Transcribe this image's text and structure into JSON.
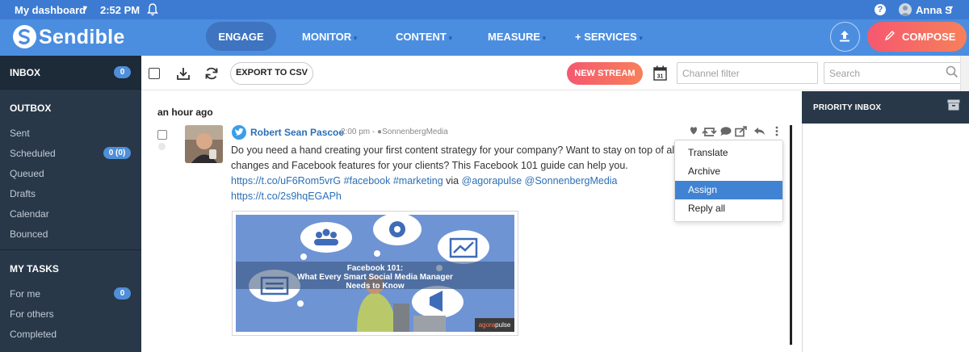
{
  "topbar": {
    "dashboard_label": "My dashboard",
    "caret_icon": "caret-down-icon",
    "time": "2:52 PM",
    "bell_icon": "bell-icon",
    "help_icon": "help-icon",
    "help_glyph": "?",
    "user_name": "Anna S"
  },
  "brand": {
    "name": "Sendible",
    "logo_icon": "sendible-logo-icon"
  },
  "nav": {
    "engage": "ENGAGE",
    "monitor": "MONITOR",
    "content": "CONTENT",
    "measure": "MEASURE",
    "services": "+ SERVICES",
    "compose": "COMPOSE",
    "upload_icon": "upload-icon",
    "compose_icon": "pencil-icon"
  },
  "sidebar": {
    "inbox": {
      "label": "INBOX",
      "count": "0"
    },
    "outbox_heading": "OUTBOX",
    "outbox_items": [
      {
        "label": "Sent"
      },
      {
        "label": "Scheduled",
        "count": "0 (0)"
      },
      {
        "label": "Queued"
      },
      {
        "label": "Drafts"
      },
      {
        "label": "Calendar"
      },
      {
        "label": "Bounced"
      }
    ],
    "tasks_heading": "MY TASKS",
    "task_items": [
      {
        "label": "For me",
        "count": "0"
      },
      {
        "label": "For others"
      },
      {
        "label": "Completed"
      }
    ]
  },
  "toolbar": {
    "export_label": "EXPORT TO CSV",
    "new_stream_label": "NEW STREAM",
    "calendar_day": "31",
    "channel_filter_placeholder": "Channel filter",
    "search_placeholder": "Search",
    "icons": [
      "select-all-checkbox",
      "download-icon",
      "refresh-icon",
      "calendar-icon",
      "search-icon"
    ]
  },
  "feed": {
    "time_group": "an hour ago",
    "post": {
      "author": "Robert Sean Pascoe",
      "time": "2:00 pm -",
      "channel": "SonnenbergMedia",
      "text_line1": "Do you need a hand creating your first content strategy for your company? Want to stay on top of algo",
      "text_line2": "changes and Facebook features for your clients? This Facebook 101 guide can help you.",
      "link1": "https://t.co/uF6Rom5vrG",
      "tag1": "#facebook",
      "tag2": "#marketing",
      "via": "via",
      "mention1": "@agorapulse",
      "mention2": "@SonnenbergMedia",
      "link2": "https://t.co/2s9hqEGAPh",
      "image": {
        "title_line1": "Facebook 101:",
        "title_line2": "What Every Smart Social Media Manager",
        "title_line3": "Needs to Know",
        "brand_a": "agora",
        "brand_b": "pulse"
      },
      "actions": [
        "like-icon",
        "retweet-icon",
        "comment-icon",
        "share-icon",
        "reply-icon",
        "more-icon"
      ]
    },
    "menu": {
      "items": [
        "Translate",
        "Archive",
        "Assign",
        "Reply all"
      ],
      "active": "Assign"
    }
  },
  "priority": {
    "label": "PRIORITY INBOX",
    "archive_icon": "archive-icon"
  },
  "colors": {
    "topbar": "#3c7bd1",
    "navbar": "#4b8ee0",
    "sidebar": "#283848",
    "accent_gradient_start": "#f5586f",
    "accent_gradient_end": "#f7805a",
    "link": "#2c6fb7",
    "menu_active": "#3f83d2"
  }
}
